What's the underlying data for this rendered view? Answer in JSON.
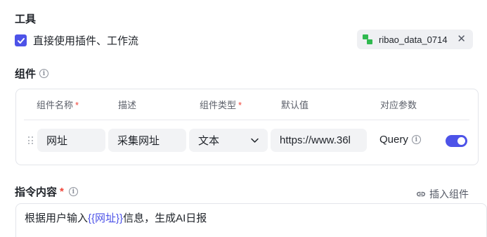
{
  "tools": {
    "title": "工具",
    "checkbox_label": "直接使用插件、工作流",
    "checked": true,
    "tag_label": "ribao_data_0714",
    "tag_close": "✕",
    "accent": "#4d53e8",
    "tag_icon_color": "#30b950"
  },
  "components": {
    "title": "组件",
    "headers": {
      "name": "组件名称",
      "desc": "描述",
      "type": "组件类型",
      "default": "默认值",
      "param": "对应参数",
      "required_mark": "*"
    },
    "row": {
      "name": "网址",
      "desc": "采集网址",
      "type": "文本",
      "default": "https://www.36l",
      "param": "Query",
      "enabled": true
    }
  },
  "instruction": {
    "title": "指令内容",
    "required_mark": "*",
    "insert_label": "插入组件",
    "text_before": "根据用户输入",
    "variable": "{{网址}}",
    "text_after": "信息，生成AI日报"
  }
}
